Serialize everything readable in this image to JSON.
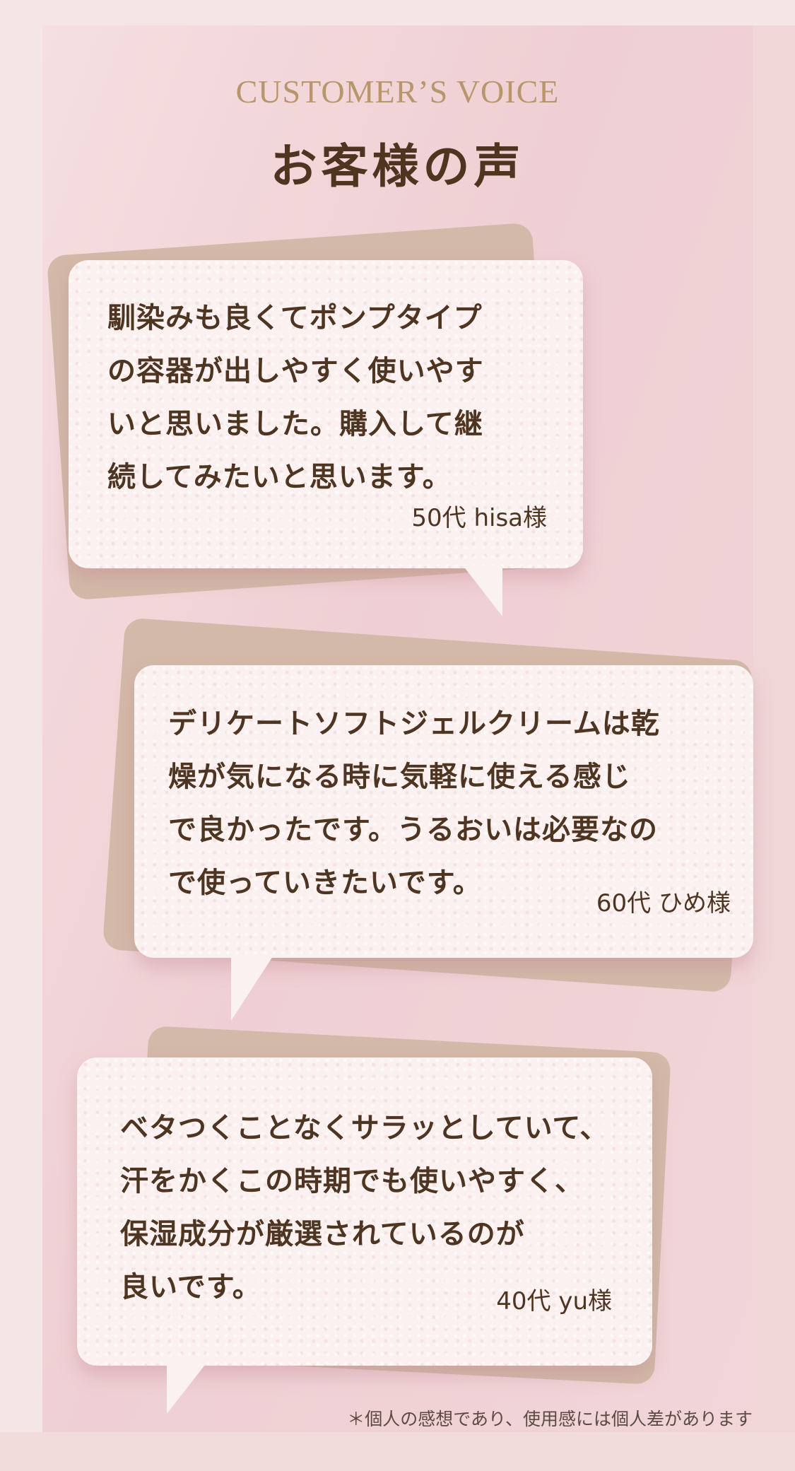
{
  "heading": {
    "english": "CUSTOMER’S VOICE",
    "japanese": "お客様の声"
  },
  "testimonials": [
    {
      "lines": [
        "馴染みも良くてポンプタイプ",
        "の容器が出しやすく使いやす",
        "いと思いました。購入して継",
        "続してみたいと思います。"
      ],
      "author": "50代 hisa様"
    },
    {
      "lines": [
        "デリケートソフトジェルクリームは乾",
        "燥が気になる時に気軽に使える感じ",
        "で良かったです。うるおいは必要なの",
        "で使っていきたいです。"
      ],
      "author": "60代 ひめ様"
    },
    {
      "lines": [
        "ベタつくことなくサラッとしていて、",
        "汗をかくこの時期でも使いやすく、",
        "保湿成分が厳選されているのが",
        "良いです。"
      ],
      "author": "40代 yu様"
    }
  ],
  "disclaimer": "＊個人の感想であり、使用感には個人差があります",
  "colors": {
    "heading_english": "#b8966c",
    "heading_japanese": "#4f3520",
    "card": "#fbf1f0",
    "card_backdrop": "#d3b9a8",
    "text": "#4e3521"
  }
}
